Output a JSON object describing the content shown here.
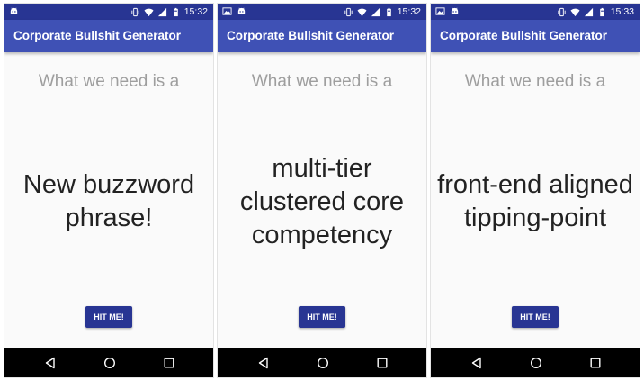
{
  "screens": [
    {
      "status": {
        "time": "15:32",
        "show_image_icon": false
      },
      "app_title": "Corporate Bullshit Generator",
      "prompt": "What we need is a",
      "phrase": "New buzzword phrase!",
      "button_label": "HIT ME!"
    },
    {
      "status": {
        "time": "15:32",
        "show_image_icon": true
      },
      "app_title": "Corporate Bullshit Generator",
      "prompt": "What we need is a",
      "phrase": "multi-tier clustered core competency",
      "button_label": "HIT ME!"
    },
    {
      "status": {
        "time": "15:33",
        "show_image_icon": true
      },
      "app_title": "Corporate Bullshit Generator",
      "prompt": "What we need is a",
      "phrase": "front-end aligned tipping-point",
      "button_label": "HIT ME!"
    }
  ],
  "icons": {
    "status_left": [
      "image-icon",
      "android-icon"
    ],
    "status_right": [
      "vibrate-icon",
      "wifi-icon",
      "signal-icon",
      "battery-icon"
    ],
    "nav": [
      "back-icon",
      "home-icon",
      "recents-icon"
    ]
  },
  "colors": {
    "status_bar": "#283593",
    "app_bar": "#3f51b5",
    "button": "#283593",
    "background": "#fafafa",
    "prompt_text": "#9e9e9e",
    "phrase_text": "#222222",
    "nav_bar": "#000000"
  }
}
